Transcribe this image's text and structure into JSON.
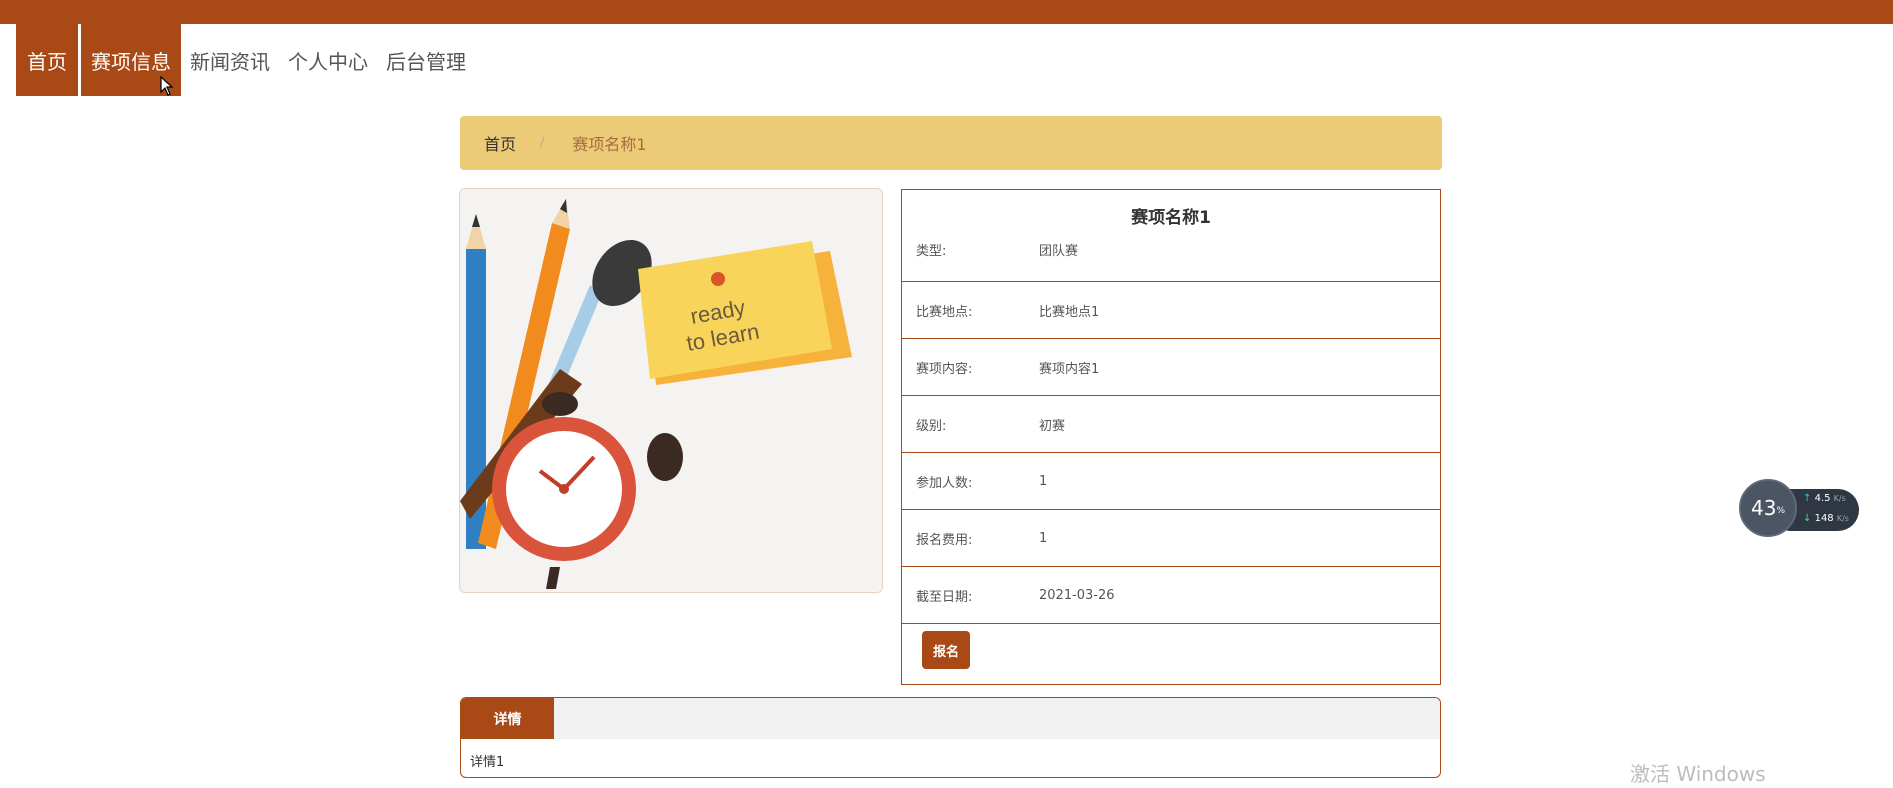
{
  "nav": {
    "items": [
      {
        "label": "首页",
        "active": true
      },
      {
        "label": "赛项信息",
        "active": true
      },
      {
        "label": "新闻资讯",
        "active": false
      },
      {
        "label": "个人中心",
        "active": false
      },
      {
        "label": "后台管理",
        "active": false
      }
    ]
  },
  "breadcrumb": {
    "home": "首页",
    "separator": "/",
    "current": "赛项名称1"
  },
  "image": {
    "note_line1": "ready",
    "note_line2": "to learn"
  },
  "detail_card": {
    "title": "赛项名称1",
    "fields": [
      {
        "label": "类型:",
        "value": "团队赛"
      },
      {
        "label": "比赛地点:",
        "value": "比赛地点1"
      },
      {
        "label": "赛项内容:",
        "value": "赛项内容1"
      },
      {
        "label": "级别:",
        "value": "初赛"
      },
      {
        "label": "参加人数:",
        "value": "1"
      },
      {
        "label": "报名费用:",
        "value": "1"
      },
      {
        "label": "截至日期:",
        "value": "2021-03-26"
      }
    ],
    "signup_label": "报名"
  },
  "details_tab": {
    "tab_label": "详情",
    "content": "详情1"
  },
  "net_monitor": {
    "percent": "43",
    "percent_unit": "%",
    "upload": "4.5",
    "download": "148",
    "unit": "K/s"
  },
  "watermark": "激活 Windows",
  "colors": {
    "brand": "#a84916",
    "breadcrumb_bg": "#eccb78"
  }
}
